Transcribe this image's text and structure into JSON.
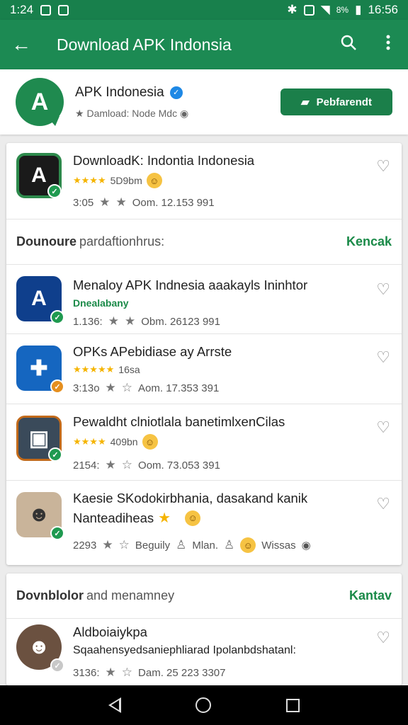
{
  "status_bar": {
    "time": "1:24",
    "battery_text": "8%",
    "clock_right": "16:56",
    "icons": [
      "gallery-icon",
      "notification-icon",
      "bluetooth-icon",
      "vibrate-icon",
      "wifi-icon",
      "signal-icon"
    ]
  },
  "app_bar": {
    "title": "Download APK Indonsia",
    "back_icon": "arrow-left-icon",
    "search_icon": "search-icon",
    "menu_icon": "more-vert-icon"
  },
  "developer": {
    "name": "APK Indonesia",
    "subtitle": "Damload: Node Mdc",
    "follow_label": "Pebfarendt",
    "accent": "#1b7f4a"
  },
  "top_app": {
    "title": "DownloadK: Indontia Indonesia",
    "rating_text": "5D9bm",
    "meta_num": "3:05",
    "meta_date": "Oom. 12.153 991"
  },
  "section1": {
    "title": "Dounoure",
    "subtitle": "pardaftionhrus:",
    "link": "Kencak",
    "apps": [
      {
        "title": "Menaloy APK Indnesia aaakayls Ininhtor",
        "tag": "Dnealabany",
        "meta_num": "1.136:",
        "meta_date": "Obm. 26123 991"
      },
      {
        "title": "OPKs APebidiase ay Arrste",
        "rating_text": "16sa",
        "meta_num": "3:13o",
        "meta_date": "Aom. 17.353 391"
      },
      {
        "title": "Pewaldht clniotlala banetimlxenCilas",
        "rating_text": "409bn",
        "meta_num": "2154:",
        "meta_date": "Oom. 73.053 391"
      },
      {
        "title": "Kaesie SKodokirbhania, dasakand kanik",
        "title2": "Nanteadiheas",
        "meta_num": "2293",
        "meta_b": "Beguily",
        "meta_c": "Mlan.",
        "meta_d": "Wissas"
      }
    ]
  },
  "section2": {
    "title": "Dovnblolor",
    "subtitle": "and menamney",
    "link": "Kantav",
    "apps": [
      {
        "title": "Aldboiaiykpa",
        "subtitle": "Sqaahensyedsaniephliarad Ipolanbdshatanl:",
        "meta_num": "3136:",
        "meta_date": "Dam. 25 223 3307"
      }
    ]
  }
}
